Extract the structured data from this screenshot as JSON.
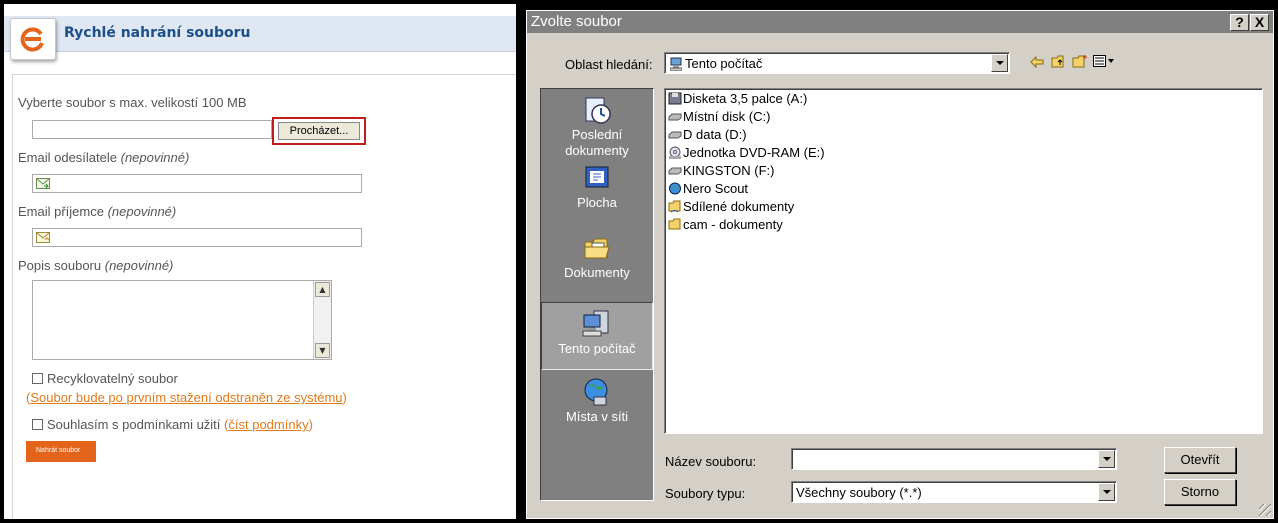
{
  "web": {
    "title": "Rychlé nahrání souboru",
    "file_label": "Vyberte soubor s max. velikostí 100 MB",
    "browse_label": "Procházet...",
    "sender_label": "Email odesílatele ",
    "sender_optional": "(nepovinné)",
    "recipient_label": "Email příjemce ",
    "recipient_optional": "(nepovinné)",
    "description_label": "Popis souboru ",
    "description_optional": "(nepovinné)",
    "recycle_label": "Recyklovatelný soubor",
    "recycle_note": "Soubor bude po prvním stažení odstraněn ze systému",
    "terms_label": "Souhlasím s podmínkami užití ",
    "terms_link": "číst podmínky",
    "submit_label": "Nahrát soubor",
    "brand_color": "#e5641c",
    "title_color": "#1c4f8c"
  },
  "dialog": {
    "title": "Zvolte soubor",
    "help_label": "?",
    "close_label": "X",
    "look_in_label": "Oblast hledání:",
    "look_in_value": "Tento počítač",
    "places": [
      {
        "label": "Poslední dokumenty",
        "icon": "recent-documents-icon"
      },
      {
        "label": "Plocha",
        "icon": "desktop-icon"
      },
      {
        "label": "Dokumenty",
        "icon": "my-documents-icon"
      },
      {
        "label": "Tento počítač",
        "icon": "my-computer-icon",
        "selected": true
      },
      {
        "label": "Místa v síti",
        "icon": "network-places-icon"
      }
    ],
    "files": [
      {
        "label": "Disketa 3,5 palce (A:)",
        "icon": "floppy-drive-icon"
      },
      {
        "label": "Místní disk (C:)",
        "icon": "hard-drive-icon"
      },
      {
        "label": "D data (D:)",
        "icon": "hard-drive-icon"
      },
      {
        "label": "Jednotka DVD-RAM (E:)",
        "icon": "dvd-drive-icon"
      },
      {
        "label": "KINGSTON (F:)",
        "icon": "removable-drive-icon"
      },
      {
        "label": "Nero Scout",
        "icon": "nero-scout-icon"
      },
      {
        "label": "Sdílené dokumenty",
        "icon": "shared-folder-icon"
      },
      {
        "label": "cam - dokumenty",
        "icon": "folder-icon"
      }
    ],
    "filename_label": "Název souboru:",
    "filename_value": "",
    "filetype_label": "Soubory typu:",
    "filetype_value": "Všechny soubory (*.*)",
    "open_label": "Otevřít",
    "cancel_label": "Storno"
  }
}
